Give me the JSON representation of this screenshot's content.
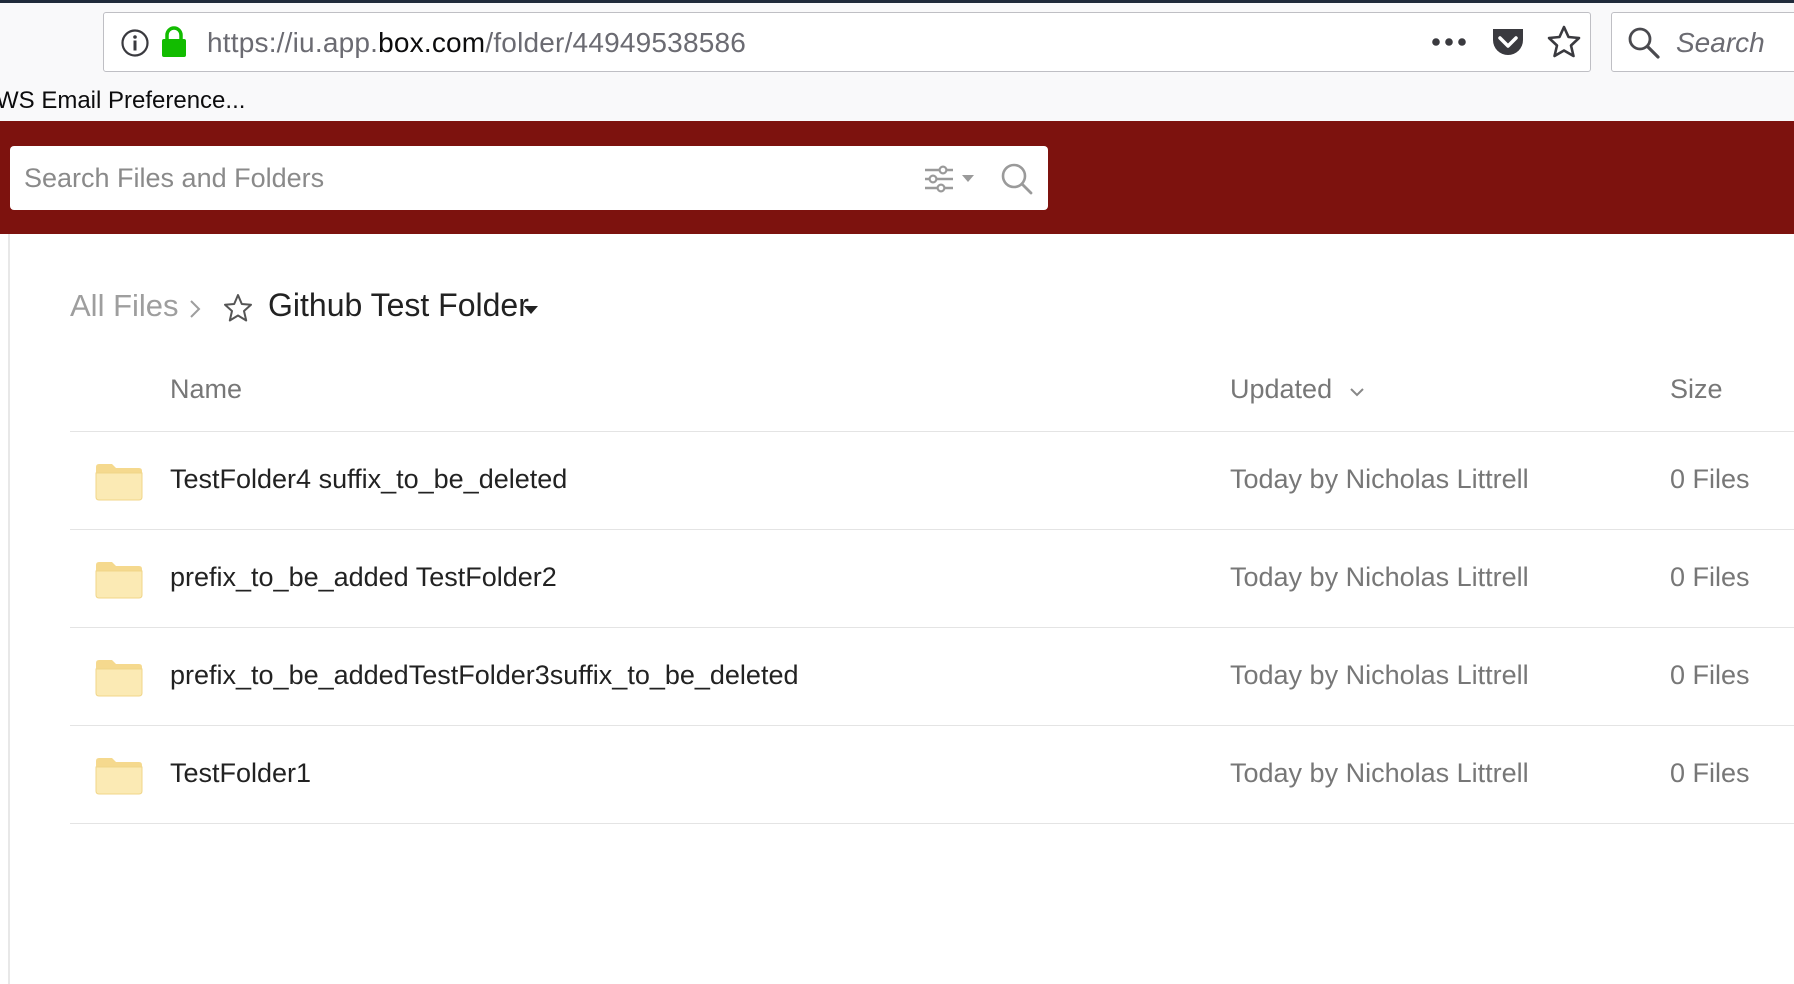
{
  "browser": {
    "url_prefix": "https://iu.app.",
    "url_domain": "box.com",
    "url_path": "/folder/44949538586",
    "search_placeholder": "Search",
    "bookmark_label": "WS Email Preference..."
  },
  "header": {
    "brand_color": "#7d120e",
    "search_placeholder": "Search Files and Folders"
  },
  "breadcrumb": {
    "root": "All Files",
    "current": "Github Test Folder"
  },
  "table": {
    "columns": {
      "name": "Name",
      "updated": "Updated",
      "size": "Size"
    },
    "rows": [
      {
        "name": "TestFolder4 suffix_to_be_deleted",
        "updated": "Today by Nicholas Littrell",
        "size": "0 Files"
      },
      {
        "name": "prefix_to_be_added TestFolder2",
        "updated": "Today by Nicholas Littrell",
        "size": "0 Files"
      },
      {
        "name": "prefix_to_be_addedTestFolder3suffix_to_be_deleted",
        "updated": "Today by Nicholas Littrell",
        "size": "0 Files"
      },
      {
        "name": "TestFolder1",
        "updated": "Today by Nicholas Littrell",
        "size": "0 Files"
      }
    ]
  }
}
